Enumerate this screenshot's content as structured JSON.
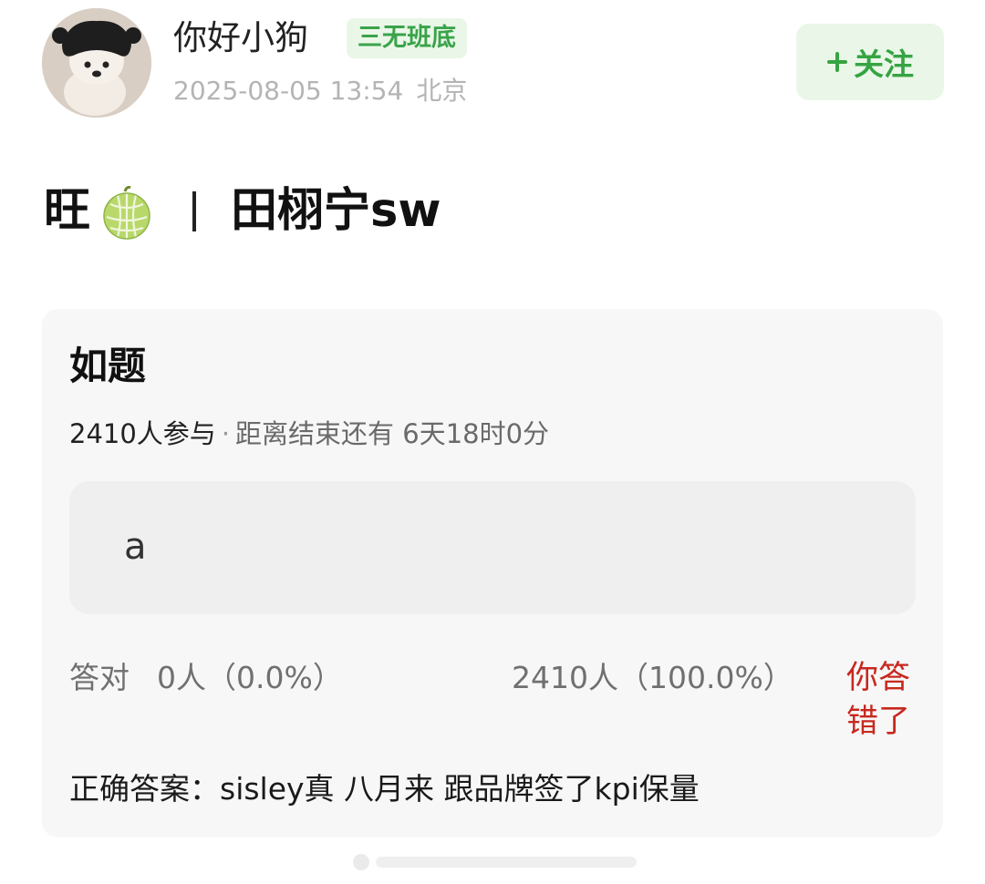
{
  "post": {
    "username": "你好小狗",
    "badge": "三无班底",
    "timestamp": "2025-08-05 13:54",
    "location": "北京",
    "follow_label": "关注",
    "title_prefix": "旺",
    "title_suffix": "田栩宁sw"
  },
  "poll": {
    "question": "如题",
    "participants": "2410人参与",
    "separator": "·",
    "time_remaining": "距离结束还有 6天18时0分",
    "option_label": "a",
    "correct_label": "答对",
    "correct_stat": "0人（0.0%）",
    "option_stat": "2410人（100.0%）",
    "result_text": "你答错了",
    "answer_text": "正确答案：sisley真 八月来 跟品牌签了kpi保量"
  },
  "colors": {
    "accent_green": "#35a443",
    "badge_bg": "#eaf7e8",
    "wrong_red": "#c8281f",
    "card_bg": "#f7f7f7"
  },
  "icons": {
    "follow": "plus-icon",
    "title_emoji": "melon-icon"
  }
}
